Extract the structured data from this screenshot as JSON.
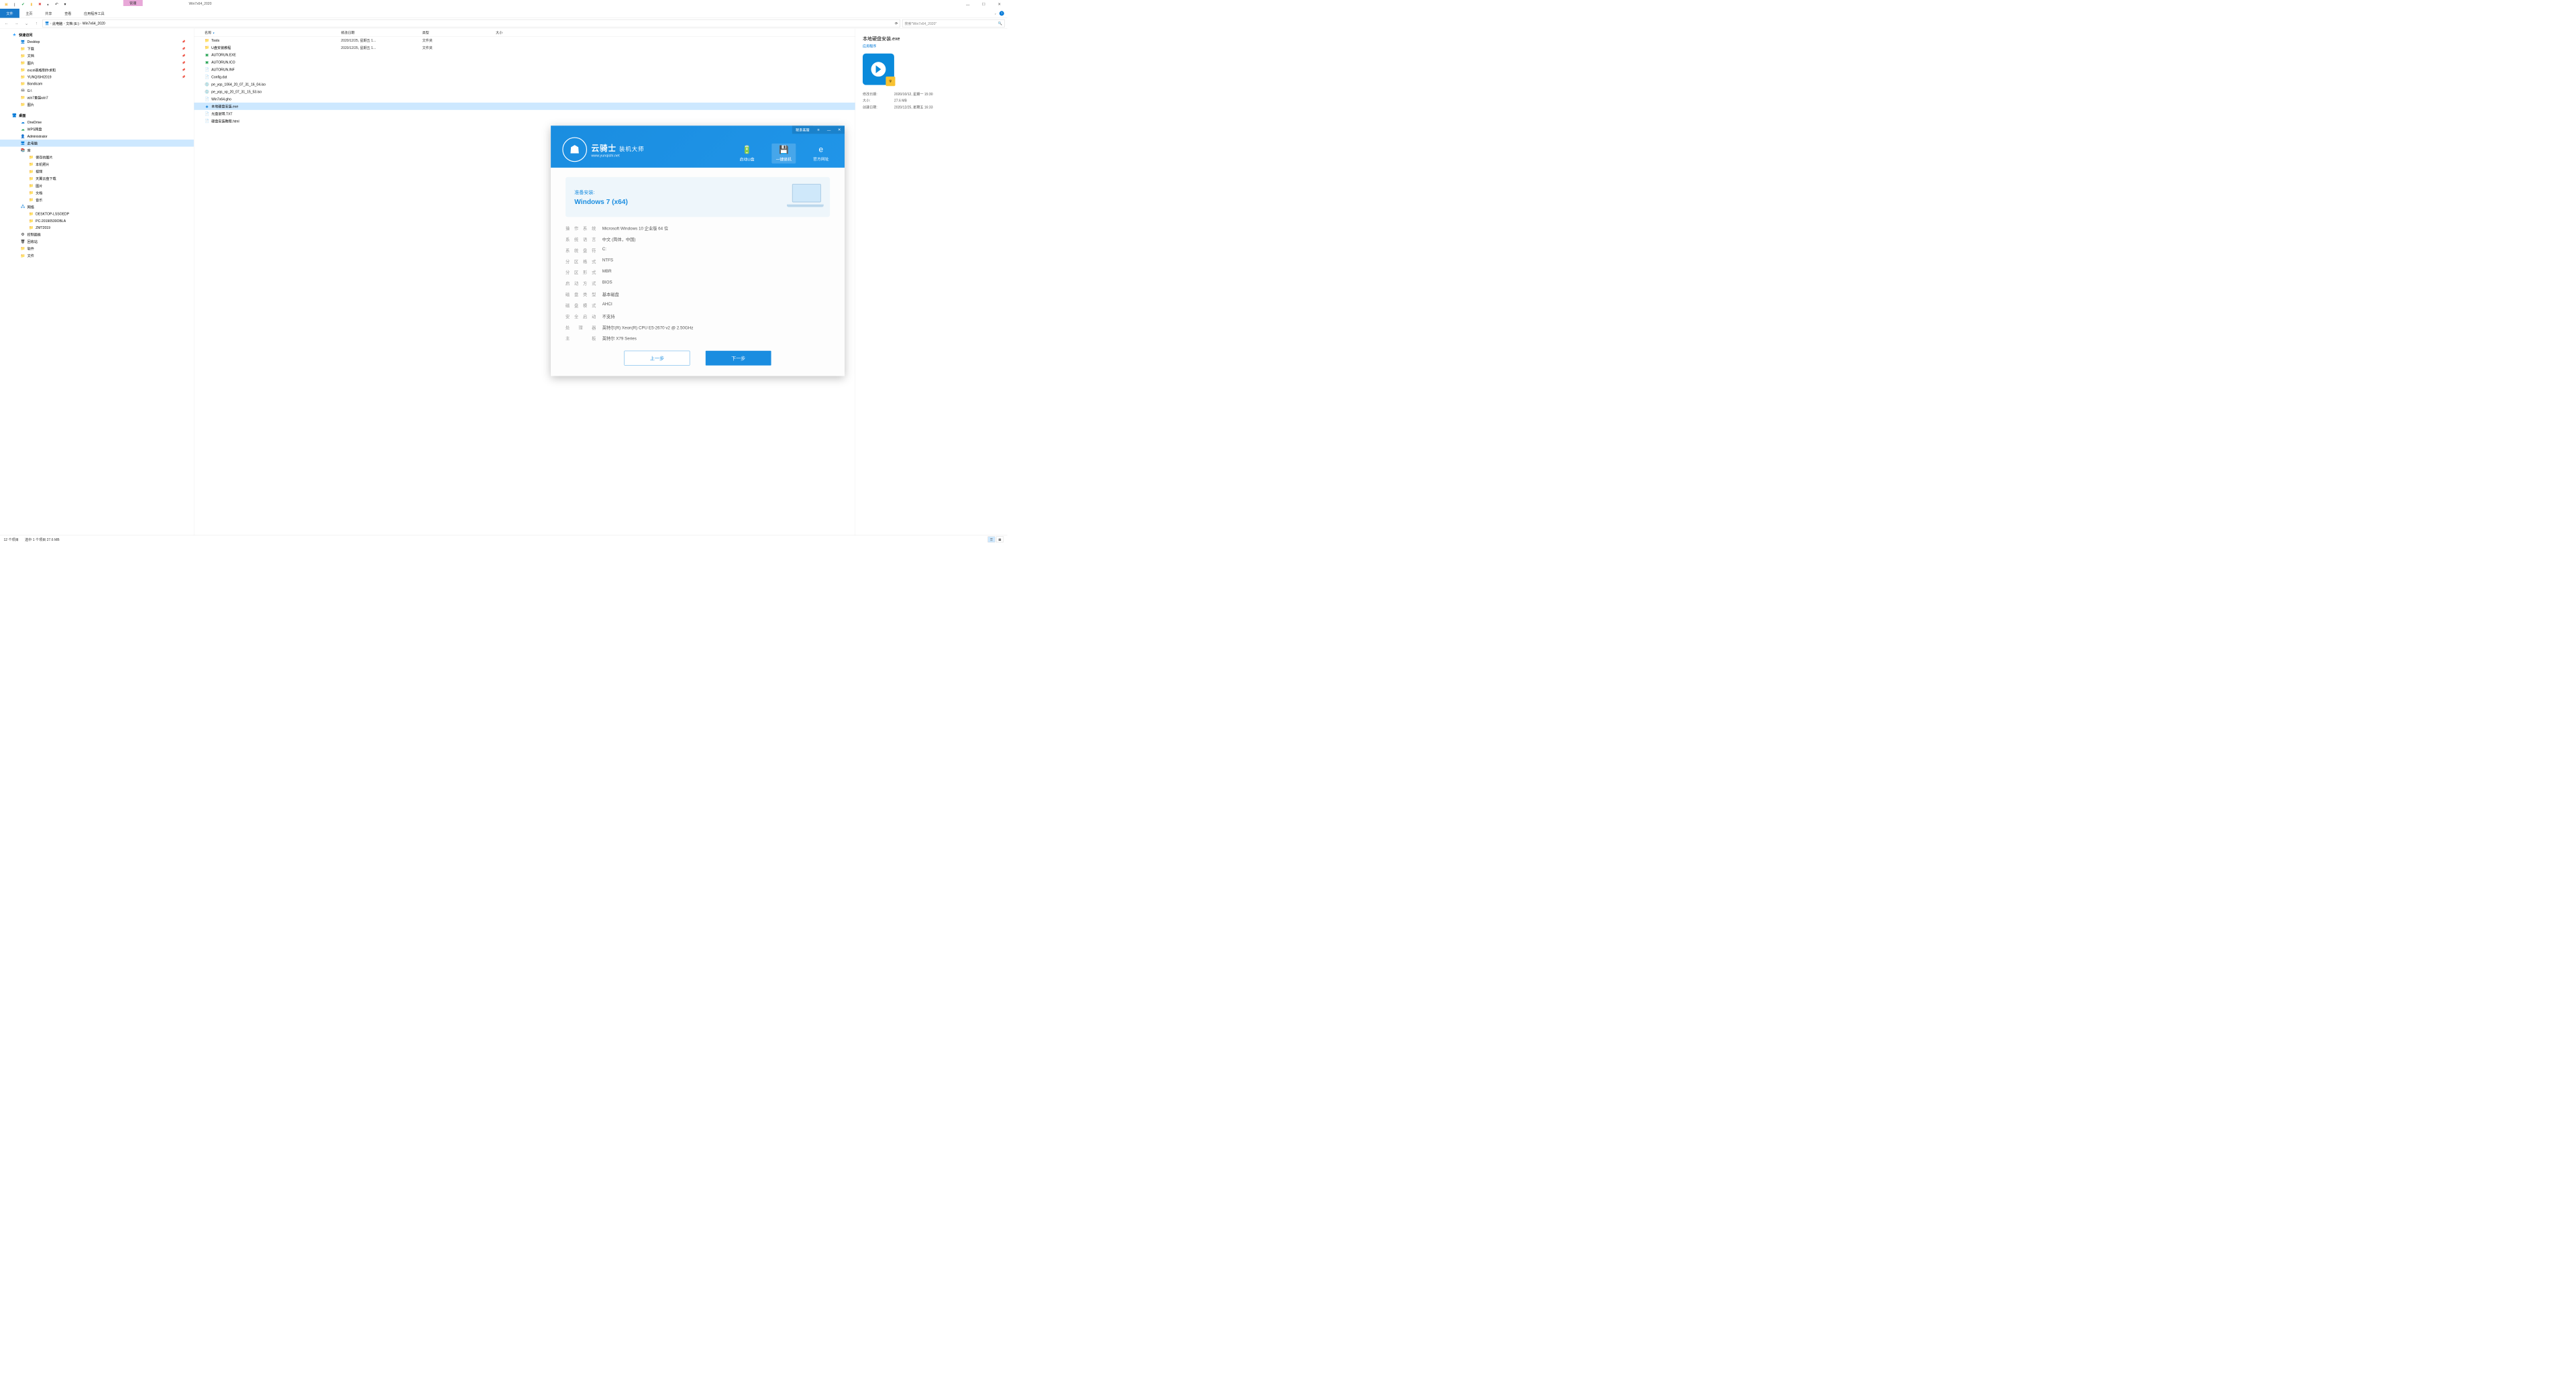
{
  "window": {
    "context_tab": "管理",
    "title": "Win7x64_2020"
  },
  "ribbon": {
    "tabs": [
      "文件",
      "主页",
      "共享",
      "查看",
      "应用程序工具"
    ],
    "active": 0
  },
  "nav": {
    "back": "←",
    "fwd": "→",
    "up": "↑",
    "refresh": "⟳",
    "crumbs": [
      "此电脑",
      "文档 (E:)",
      "Win7x64_2020"
    ],
    "search_placeholder": "搜索\"Win7x64_2020\""
  },
  "navpane": {
    "quick": {
      "label": "快速访问",
      "items": [
        {
          "label": "Desktop",
          "pin": true,
          "icon": "monitor"
        },
        {
          "label": "下载",
          "pin": true,
          "icon": "folder"
        },
        {
          "label": "文档",
          "pin": true,
          "icon": "folder"
        },
        {
          "label": "图片",
          "pin": true,
          "icon": "folder"
        },
        {
          "label": "excel表格制作求和",
          "pin": true,
          "icon": "folder"
        },
        {
          "label": "YUNQISHI2019",
          "pin": true,
          "icon": "folder"
        },
        {
          "label": "Bandicam",
          "pin": false,
          "icon": "folder"
        },
        {
          "label": "G:\\",
          "pin": false,
          "icon": "drive"
        },
        {
          "label": "win7重装win7",
          "pin": false,
          "icon": "folder"
        },
        {
          "label": "图片",
          "pin": false,
          "icon": "folder"
        }
      ]
    },
    "desktop": {
      "label": "桌面",
      "items": [
        {
          "label": "OneDrive",
          "icon": "cloud-blue"
        },
        {
          "label": "WPS网盘",
          "icon": "cloud-green"
        },
        {
          "label": "Administrator",
          "icon": "user"
        },
        {
          "label": "此电脑",
          "icon": "pc",
          "sel": true
        },
        {
          "label": "库",
          "icon": "lib",
          "children": [
            {
              "label": "保存的图片"
            },
            {
              "label": "本机照片"
            },
            {
              "label": "视频"
            },
            {
              "label": "天翼云盘下载"
            },
            {
              "label": "图片"
            },
            {
              "label": "文档"
            },
            {
              "label": "音乐"
            }
          ]
        },
        {
          "label": "网络",
          "icon": "net",
          "children": [
            {
              "label": "DESKTOP-LSSOEDP"
            },
            {
              "label": "PC-20190530OBLA"
            },
            {
              "label": "ZMT2019"
            }
          ]
        },
        {
          "label": "控制面板",
          "icon": "cp"
        },
        {
          "label": "回收站",
          "icon": "bin"
        },
        {
          "label": "软件",
          "icon": "folder"
        },
        {
          "label": "文件",
          "icon": "folder"
        }
      ]
    }
  },
  "columns": {
    "name": "名称",
    "date": "修改日期",
    "type": "类型",
    "size": "大小"
  },
  "files": [
    {
      "name": "Tools",
      "date": "2020/12/25, 星期五 1...",
      "type": "文件夹",
      "icon": "folder"
    },
    {
      "name": "U盘安装教程",
      "date": "2020/12/25, 星期五 1...",
      "type": "文件夹",
      "icon": "folder"
    },
    {
      "name": "AUTORUN.EXE",
      "icon": "exe-green"
    },
    {
      "name": "AUTORUN.ICO",
      "icon": "exe-green"
    },
    {
      "name": "AUTORUN.INF",
      "icon": "file"
    },
    {
      "name": "Config.dat",
      "icon": "file"
    },
    {
      "name": "pe_yqs_1064_20_07_31_16_04.iso",
      "icon": "disc"
    },
    {
      "name": "pe_yqs_xp_20_07_31_15_53.iso",
      "icon": "disc"
    },
    {
      "name": "Win7x64.gho",
      "icon": "file"
    },
    {
      "name": "本地硬盘安装.exe",
      "icon": "exe-blue",
      "sel": true
    },
    {
      "name": "光盘说明.TXT",
      "icon": "txt"
    },
    {
      "name": "硬盘安装教程.html",
      "icon": "file"
    }
  ],
  "details": {
    "title": "本地硬盘安装.exe",
    "subtype": "应用程序",
    "props": [
      {
        "k": "修改日期:",
        "v": "2020/10/12, 星期一 15:30"
      },
      {
        "k": "大小:",
        "v": "27.6 MB"
      },
      {
        "k": "创建日期:",
        "v": "2020/12/25, 星期五 16:33"
      }
    ]
  },
  "statusbar": {
    "count": "12 个项目",
    "sel": "选中 1 个项目  27.6 MB"
  },
  "installer": {
    "support": "联系客服",
    "logo": {
      "brand": "云骑士",
      "sub": "装机大师",
      "url": "www.yunqishi.net"
    },
    "tabs": [
      {
        "label": "启动U盘",
        "icon": "🔋"
      },
      {
        "label": "一键装机",
        "icon": "💾",
        "active": true
      },
      {
        "label": "官方网址",
        "icon": "e"
      }
    ],
    "card": {
      "l1": "准备安装:",
      "l2": "Windows 7 (x64)"
    },
    "info": [
      {
        "k": "操作系统",
        "v": "Microsoft Windows 10 企业版 64 位"
      },
      {
        "k": "系统语言",
        "v": "中文 (简体，中国)"
      },
      {
        "k": "系统盘符",
        "v": "C:"
      },
      {
        "k": "分区格式",
        "v": "NTFS"
      },
      {
        "k": "分区形式",
        "v": "MBR"
      },
      {
        "k": "启动方式",
        "v": "BIOS"
      },
      {
        "k": "磁盘类型",
        "v": "基本磁盘"
      },
      {
        "k": "磁盘模式",
        "v": "AHCI"
      },
      {
        "k": "安全启动",
        "v": "不支持"
      },
      {
        "k": "处理器",
        "v": "英特尔(R) Xeon(R) CPU E5-2670 v2 @ 2.50GHz"
      },
      {
        "k": "主板",
        "v": "英特尔 X79 Series"
      }
    ],
    "btns": {
      "prev": "上一步",
      "next": "下一步"
    }
  }
}
